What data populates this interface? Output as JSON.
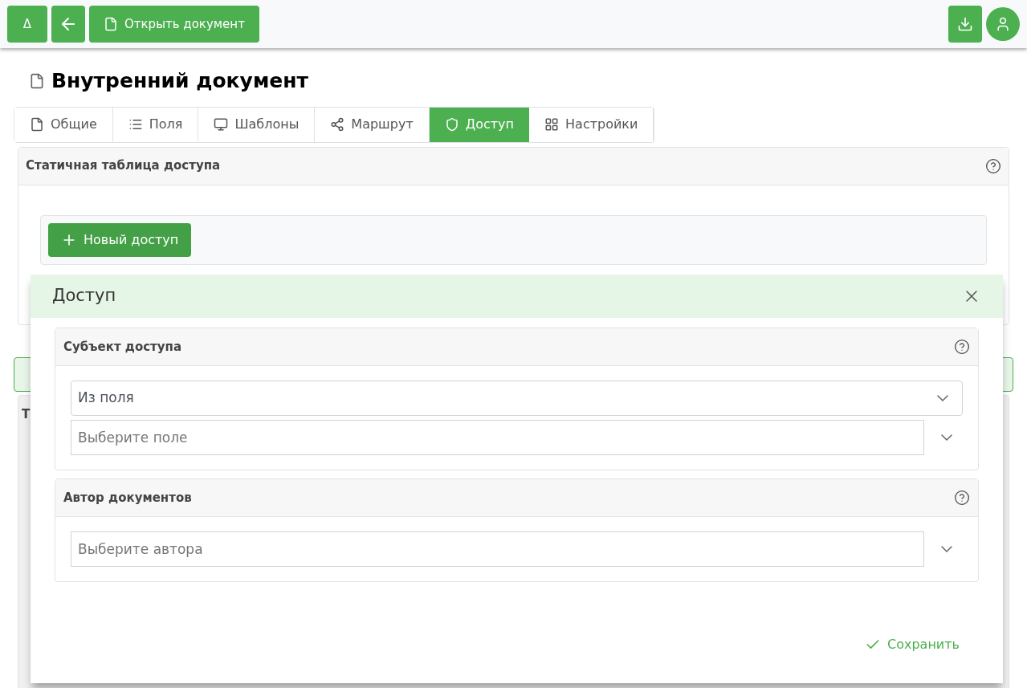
{
  "toolbar": {
    "delta_button": "Δ",
    "open_button": "Открыть документ"
  },
  "page_title": "Внутренний документ",
  "tabs": [
    {
      "label": "Общие",
      "kind": "file",
      "selected": false
    },
    {
      "label": "Поля",
      "kind": "list",
      "selected": false
    },
    {
      "label": "Шаблоны",
      "kind": "monitor",
      "selected": false
    },
    {
      "label": "Маршрут",
      "kind": "share",
      "selected": false
    },
    {
      "label": "Доступ",
      "kind": "shield",
      "selected": true
    },
    {
      "label": "Настройки",
      "kind": "grid",
      "selected": false
    }
  ],
  "static_panel": {
    "title": "Статичная таблица доступа",
    "new_button": "Новый доступ"
  },
  "lower_panel": {
    "title": "Т"
  },
  "dialog": {
    "title": "Доступ",
    "sections": [
      {
        "title": "Субъект доступа",
        "fields": [
          {
            "kind": "select",
            "value": "Из поля"
          },
          {
            "kind": "combo",
            "placeholder": "Выберите поле"
          }
        ]
      },
      {
        "title": "Автор документов",
        "fields": [
          {
            "kind": "combo",
            "placeholder": "Выберите автора"
          }
        ]
      }
    ],
    "save_button": "Сохранить"
  }
}
